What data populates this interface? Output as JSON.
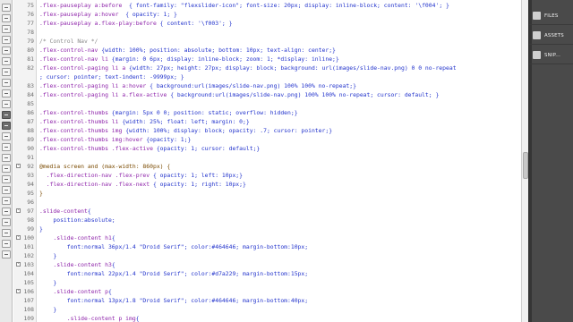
{
  "editor": {
    "lines": [
      {
        "n": "75",
        "fold": "",
        "segs": [
          {
            "c": "sel",
            "t": ".flex-pauseplay a:before"
          },
          {
            "c": "txt",
            "t": "  { font-family: \"flexslider-icon\"; font-size: 20px; display: inline-block; content: '\\f004'; }"
          }
        ]
      },
      {
        "n": "76",
        "fold": "",
        "segs": [
          {
            "c": "sel",
            "t": ".flex-pauseplay a:hover"
          },
          {
            "c": "txt",
            "t": "  { opacity: 1; }"
          }
        ]
      },
      {
        "n": "77",
        "fold": "",
        "segs": [
          {
            "c": "sel",
            "t": ".flex-pauseplay a.flex-play:before"
          },
          {
            "c": "txt",
            "t": " { content: '\\f003'; }"
          }
        ]
      },
      {
        "n": "78",
        "fold": "",
        "segs": []
      },
      {
        "n": "79",
        "fold": "",
        "segs": [
          {
            "c": "com",
            "t": "/* Control Nav */"
          }
        ]
      },
      {
        "n": "80",
        "fold": "",
        "segs": [
          {
            "c": "sel",
            "t": ".flex-control-nav"
          },
          {
            "c": "txt",
            "t": " {width: 100%; position: absolute; bottom: 10px; text-align: center;}"
          }
        ]
      },
      {
        "n": "81",
        "fold": "",
        "segs": [
          {
            "c": "sel",
            "t": ".flex-control-nav li"
          },
          {
            "c": "txt",
            "t": " {margin: 0 6px; display: inline-block; zoom: 1; *display: inline;}"
          }
        ]
      },
      {
        "n": "82",
        "fold": "",
        "segs": [
          {
            "c": "sel",
            "t": ".flex-control-paging li a"
          },
          {
            "c": "txt",
            "t": " {width: 27px; height: 27px; display: block; background: url(images/slide-nav.png) 0 0 no-repeat"
          }
        ]
      },
      {
        "n": "",
        "fold": "",
        "segs": [
          {
            "c": "txt",
            "t": "; cursor: pointer; text-indent: -9999px; }"
          }
        ]
      },
      {
        "n": "83",
        "fold": "",
        "segs": [
          {
            "c": "sel",
            "t": ".flex-control-paging li a:hover"
          },
          {
            "c": "txt",
            "t": " { background:url(images/slide-nav.png) 100% 100% no-repeat;}"
          }
        ]
      },
      {
        "n": "84",
        "fold": "",
        "segs": [
          {
            "c": "sel",
            "t": ".flex-control-paging li a.flex-active"
          },
          {
            "c": "txt",
            "t": " { background:url(images/slide-nav.png) 100% 100% no-repeat; cursor: default; }"
          }
        ]
      },
      {
        "n": "85",
        "fold": "",
        "segs": []
      },
      {
        "n": "86",
        "fold": "",
        "segs": [
          {
            "c": "sel",
            "t": ".flex-control-thumbs"
          },
          {
            "c": "txt",
            "t": " {margin: 5px 0 0; position: static; overflow: hidden;}"
          }
        ]
      },
      {
        "n": "87",
        "fold": "",
        "segs": [
          {
            "c": "sel",
            "t": ".flex-control-thumbs li"
          },
          {
            "c": "txt",
            "t": " {width: 25%; float: left; margin: 0;}"
          }
        ]
      },
      {
        "n": "88",
        "fold": "",
        "segs": [
          {
            "c": "sel",
            "t": ".flex-control-thumbs img"
          },
          {
            "c": "txt",
            "t": " {width: 100%; display: block; opacity: .7; cursor: pointer;}"
          }
        ]
      },
      {
        "n": "89",
        "fold": "",
        "segs": [
          {
            "c": "sel",
            "t": ".flex-control-thumbs img:hover"
          },
          {
            "c": "txt",
            "t": " {opacity: 1;}"
          }
        ]
      },
      {
        "n": "90",
        "fold": "",
        "segs": [
          {
            "c": "sel",
            "t": ".flex-control-thumbs .flex-active"
          },
          {
            "c": "txt",
            "t": " {opacity: 1; cursor: default;}"
          }
        ]
      },
      {
        "n": "91",
        "fold": "",
        "segs": []
      },
      {
        "n": "92",
        "fold": "-",
        "segs": [
          {
            "c": "at",
            "t": "@media screen and (max-width: 860px) {"
          }
        ]
      },
      {
        "n": "93",
        "fold": "",
        "segs": [
          {
            "c": "sel",
            "t": "  .flex-direction-nav .flex-prev"
          },
          {
            "c": "txt",
            "t": " { opacity: 1; left: 10px;}"
          }
        ]
      },
      {
        "n": "94",
        "fold": "",
        "segs": [
          {
            "c": "sel",
            "t": "  .flex-direction-nav .flex-next"
          },
          {
            "c": "txt",
            "t": " { opacity: 1; right: 10px;}"
          }
        ]
      },
      {
        "n": "95",
        "fold": "",
        "segs": [
          {
            "c": "at",
            "t": "}"
          }
        ]
      },
      {
        "n": "96",
        "fold": "",
        "segs": []
      },
      {
        "n": "97",
        "fold": "-",
        "segs": [
          {
            "c": "sel",
            "t": ".slide-content"
          },
          {
            "c": "txt",
            "t": "{"
          }
        ]
      },
      {
        "n": "98",
        "fold": "",
        "segs": [
          {
            "c": "txt",
            "t": "    position:absolute;"
          }
        ]
      },
      {
        "n": "99",
        "fold": "",
        "segs": [
          {
            "c": "txt",
            "t": "}"
          }
        ]
      },
      {
        "n": "100",
        "fold": "-",
        "segs": [
          {
            "c": "sel",
            "t": "    .slide-content h1"
          },
          {
            "c": "txt",
            "t": "{"
          }
        ]
      },
      {
        "n": "101",
        "fold": "",
        "segs": [
          {
            "c": "txt",
            "t": "        font:normal 36px/1.4 \"Droid Serif\"; color:#464646; margin-bottom:10px;"
          }
        ]
      },
      {
        "n": "102",
        "fold": "",
        "segs": [
          {
            "c": "txt",
            "t": "    }"
          }
        ]
      },
      {
        "n": "103",
        "fold": "-",
        "segs": [
          {
            "c": "sel",
            "t": "    .slide-content h3"
          },
          {
            "c": "txt",
            "t": "{"
          }
        ]
      },
      {
        "n": "104",
        "fold": "",
        "segs": [
          {
            "c": "txt",
            "t": "        font:normal 22px/1.4 \"Droid Serif\"; color:#d7a229; margin-bottom:15px;"
          }
        ]
      },
      {
        "n": "105",
        "fold": "",
        "segs": [
          {
            "c": "txt",
            "t": "    }"
          }
        ]
      },
      {
        "n": "106",
        "fold": "-",
        "segs": [
          {
            "c": "sel",
            "t": "    .slide-content p"
          },
          {
            "c": "txt",
            "t": "{"
          }
        ]
      },
      {
        "n": "107",
        "fold": "",
        "segs": [
          {
            "c": "txt",
            "t": "        font:normal 13px/1.8 \"Droid Serif\"; color:#464646; margin-bottom:40px;"
          }
        ]
      },
      {
        "n": "108",
        "fold": "",
        "segs": [
          {
            "c": "txt",
            "t": "    }"
          }
        ]
      },
      {
        "n": "109",
        "fold": "",
        "segs": [
          {
            "c": "sel",
            "t": "        .slide-content p img"
          },
          {
            "c": "txt",
            "t": "{"
          }
        ]
      }
    ]
  },
  "colors": {
    "selector": "#8e24aa",
    "text": "#2233cc",
    "comment": "#8a8a8a",
    "at_rule": "#7a4a00"
  },
  "panel": {
    "items": [
      {
        "label": "FILES",
        "icon": "files-icon"
      },
      {
        "label": "ASSETS",
        "icon": "assets-icon"
      },
      {
        "label": "SNIP...",
        "icon": "snippets-icon"
      }
    ]
  },
  "tools": [
    "tool-icon",
    "tool-icon",
    "tool-icon",
    "tool-icon",
    "tool-icon",
    "tool-icon",
    "tool-icon",
    "tool-icon",
    "tool-icon",
    "tool-icon",
    "tool-icon",
    "tool-icon",
    "tool-icon",
    "tool-icon",
    "tool-icon",
    "tool-icon",
    "tool-icon",
    "tool-icon",
    "tool-icon",
    "tool-icon",
    "tool-icon",
    "tool-icon",
    "tool-icon",
    "tool-icon"
  ]
}
